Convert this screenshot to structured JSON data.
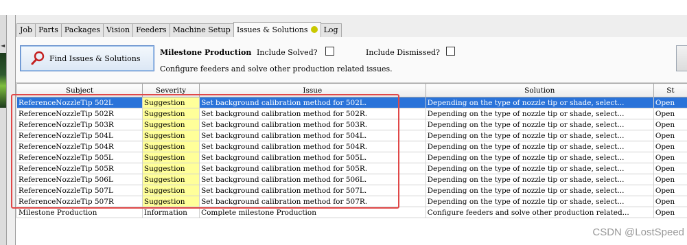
{
  "tabs": [
    {
      "label": "Job"
    },
    {
      "label": "Parts"
    },
    {
      "label": "Packages"
    },
    {
      "label": "Vision"
    },
    {
      "label": "Feeders"
    },
    {
      "label": "Machine Setup"
    },
    {
      "label": "Issues & Solutions",
      "active": true,
      "indicator_color": "#c9c800"
    },
    {
      "label": "Log"
    }
  ],
  "toolbar": {
    "find_button_label": "Find Issues & Solutions",
    "milestone_title": "Milestone Production",
    "milestone_desc": "Configure feeders and solve other production related issues.",
    "include_solved_label": "Include Solved?",
    "include_dismissed_label": "Include Dismissed?",
    "include_solved_checked": false,
    "include_dismissed_checked": false
  },
  "table": {
    "columns": [
      "Subject",
      "Severity",
      "Issue",
      "Solution",
      "St"
    ],
    "rows": [
      {
        "subject": "ReferenceNozzleTip 502L",
        "severity": "Suggestion",
        "issue": "Set background calibration method for 502L.",
        "solution": "Depending on the type of nozzle tip or shade, select...",
        "state": "Open",
        "selected": true
      },
      {
        "subject": "ReferenceNozzleTip 502R",
        "severity": "Suggestion",
        "issue": "Set background calibration method for 502R.",
        "solution": "Depending on the type of nozzle tip or shade, select...",
        "state": "Open"
      },
      {
        "subject": "ReferenceNozzleTip 503R",
        "severity": "Suggestion",
        "issue": "Set background calibration method for 503R.",
        "solution": "Depending on the type of nozzle tip or shade, select...",
        "state": "Open"
      },
      {
        "subject": "ReferenceNozzleTip 504L",
        "severity": "Suggestion",
        "issue": "Set background calibration method for 504L.",
        "solution": "Depending on the type of nozzle tip or shade, select...",
        "state": "Open"
      },
      {
        "subject": "ReferenceNozzleTip 504R",
        "severity": "Suggestion",
        "issue": "Set background calibration method for 504R.",
        "solution": "Depending on the type of nozzle tip or shade, select...",
        "state": "Open"
      },
      {
        "subject": "ReferenceNozzleTip 505L",
        "severity": "Suggestion",
        "issue": "Set background calibration method for 505L.",
        "solution": "Depending on the type of nozzle tip or shade, select...",
        "state": "Open"
      },
      {
        "subject": "ReferenceNozzleTip 505R",
        "severity": "Suggestion",
        "issue": "Set background calibration method for 505R.",
        "solution": "Depending on the type of nozzle tip or shade, select...",
        "state": "Open"
      },
      {
        "subject": "ReferenceNozzleTip 506L",
        "severity": "Suggestion",
        "issue": "Set background calibration method for 506L.",
        "solution": "Depending on the type of nozzle tip or shade, select...",
        "state": "Open"
      },
      {
        "subject": "ReferenceNozzleTip 507L",
        "severity": "Suggestion",
        "issue": "Set background calibration method for 507L.",
        "solution": "Depending on the type of nozzle tip or shade, select...",
        "state": "Open"
      },
      {
        "subject": "ReferenceNozzleTip 507R",
        "severity": "Suggestion",
        "issue": "Set background calibration method for 507R.",
        "solution": "Depending on the type of nozzle tip or shade, select...",
        "state": "Open"
      },
      {
        "subject": "Milestone Production",
        "severity": "Information",
        "issue": "Complete milestone Production",
        "solution": "Configure feeders and solve other production related...",
        "state": "Open"
      }
    ]
  },
  "colors": {
    "selection": "#2a73d9",
    "suggestion_bg": "#ffff99",
    "highlight_box": "#e04848"
  },
  "watermark": "CSDN @LostSpeed"
}
